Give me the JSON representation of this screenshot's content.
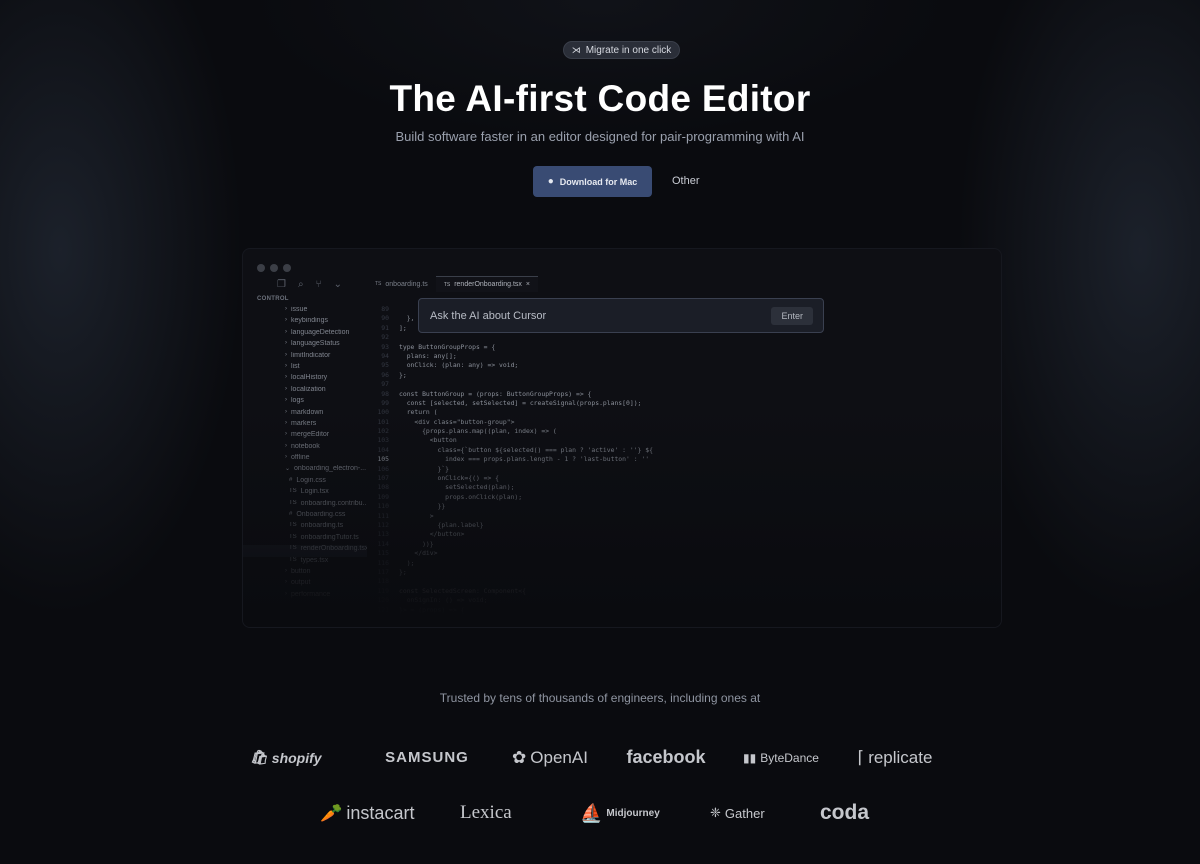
{
  "hero": {
    "badge": "Migrate in one click",
    "title": "The AI-first Code Editor",
    "subtitle": "Build software faster in an editor designed for pair-programming with AI",
    "download": "Download for Mac",
    "other": "Other"
  },
  "editor": {
    "section": "CONTROL",
    "tabs": [
      {
        "label": "onboarding.ts"
      },
      {
        "label": "renderOnboarding.tsx",
        "active": true
      }
    ],
    "sidebar": [
      "issue",
      "keybindings",
      "languageDetection",
      "languageStatus",
      "limitIndicator",
      "list",
      "localHistory",
      "localization",
      "logs",
      "markdown",
      "markers",
      "mergeEditor",
      "notebook",
      "offline",
      "onboarding_electron-...",
      "Login.css",
      "Login.tsx",
      "onboarding.contribu...",
      "Onboarding.css",
      "onboarding.ts",
      "onboardingTutor.ts",
      "renderOnboarding.tsx",
      "types.tsx",
      "button",
      "output",
      "performance"
    ],
    "code": [
      {
        "n": "89",
        "t": "      }"
      },
      {
        "n": "90",
        "t": "  },"
      },
      {
        "n": "91",
        "t": "];"
      },
      {
        "n": "92",
        "t": ""
      },
      {
        "n": "93",
        "t": "type ButtonGroupProps = {"
      },
      {
        "n": "94",
        "t": "  plans: any[];"
      },
      {
        "n": "95",
        "t": "  onClick: (plan: any) => void;"
      },
      {
        "n": "96",
        "t": "};"
      },
      {
        "n": "97",
        "t": ""
      },
      {
        "n": "98",
        "t": "const ButtonGroup = (props: ButtonGroupProps) => {"
      },
      {
        "n": "99",
        "t": "  const [selected, setSelected] = createSignal(props.plans[0]);"
      },
      {
        "n": "100",
        "t": "  return ("
      },
      {
        "n": "101",
        "t": "    <div class=\"button-group\">"
      },
      {
        "n": "102",
        "t": "      {props.plans.map((plan, index) => ("
      },
      {
        "n": "103",
        "t": "        <button"
      },
      {
        "n": "104",
        "t": "          class={`button ${selected() === plan ? 'active' : ''} ${"
      },
      {
        "n": "105",
        "t": "            index === props.plans.length - 1 ? 'last-button' : ''"
      },
      {
        "n": "106",
        "t": "          }`}"
      },
      {
        "n": "107",
        "t": "          onClick={() => {"
      },
      {
        "n": "108",
        "t": "            setSelected(plan);"
      },
      {
        "n": "109",
        "t": "            props.onClick(plan);"
      },
      {
        "n": "110",
        "t": "          }}"
      },
      {
        "n": "111",
        "t": "        >"
      },
      {
        "n": "112",
        "t": "          {plan.label}"
      },
      {
        "n": "113",
        "t": "        </button>"
      },
      {
        "n": "114",
        "t": "      ))}"
      },
      {
        "n": "115",
        "t": "    </div>"
      },
      {
        "n": "116",
        "t": "  );"
      },
      {
        "n": "117",
        "t": "};"
      },
      {
        "n": "118",
        "t": ""
      },
      {
        "n": "119",
        "t": "const SelectedScreen: Component<{"
      },
      {
        "n": "120",
        "t": "  onSignIn: () => void;"
      },
      {
        "n": "121",
        "t": "}> = (props) => {"
      }
    ],
    "current_line": "105",
    "ask_placeholder": "Ask the AI about Cursor",
    "enter": "Enter"
  },
  "trusted": "Trusted by tens of thousands of engineers, including ones at",
  "logos_row1": [
    "shopify",
    "SAMSUNG",
    "OpenAI",
    "facebook",
    "ByteDance",
    "replicate"
  ],
  "logos_row2": [
    "instacart",
    "Lexica",
    "Midjourney",
    "Gather",
    "coda"
  ],
  "colors": {
    "background": "#0a0b0f",
    "primary_button": "#394b73"
  }
}
